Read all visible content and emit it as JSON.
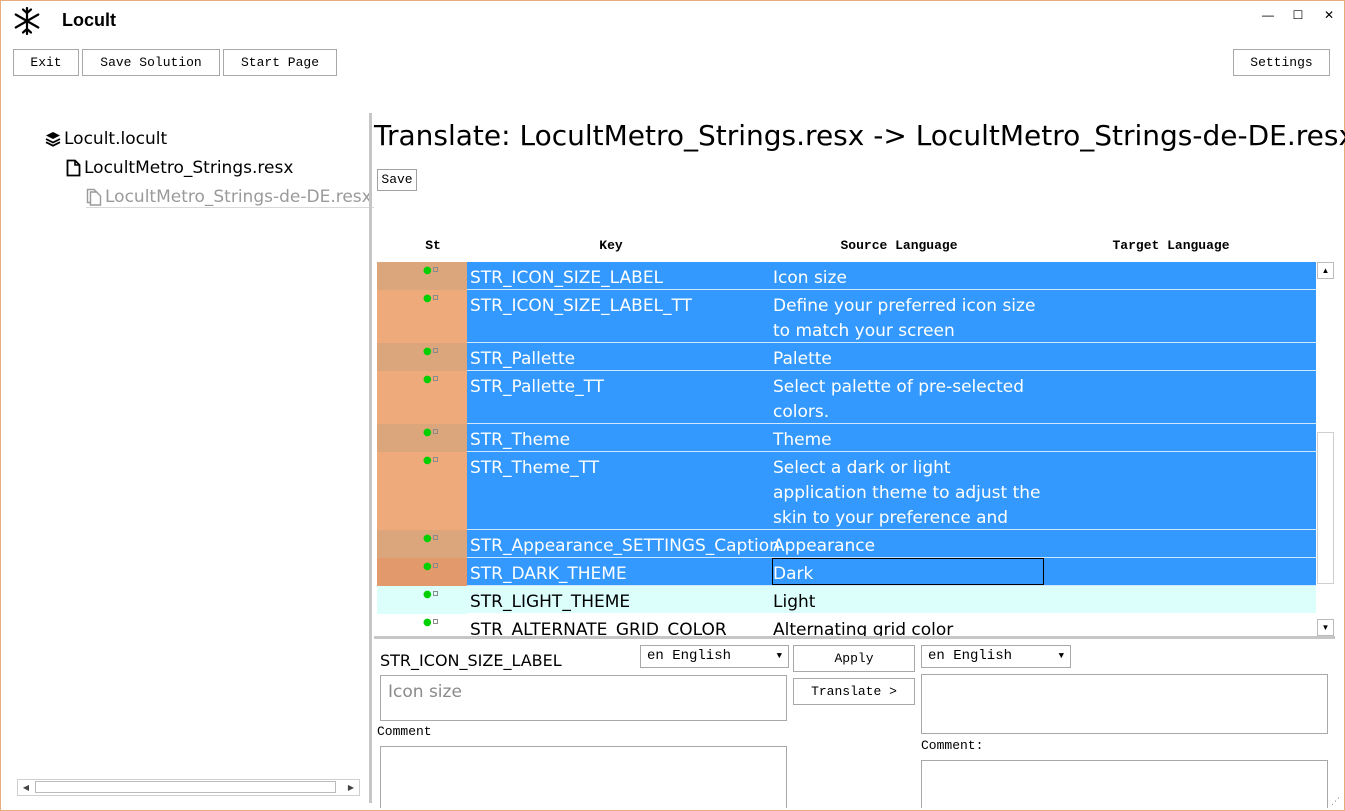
{
  "app": {
    "title": "Locult",
    "icon": "snowflake-icon"
  },
  "window_controls": {
    "minimize": "—",
    "maximize": "☐",
    "close": "✕"
  },
  "toolbar": {
    "exit": "Exit",
    "save_solution": "Save Solution",
    "start_page": "Start Page",
    "settings": "Settings"
  },
  "tree": {
    "items": [
      {
        "label": "Locult.locult",
        "icon": "solution-stack-icon"
      },
      {
        "label": "LocultMetro_Strings.resx",
        "icon": "file-icon"
      },
      {
        "label": "LocultMetro_Strings-de-DE.resx",
        "icon": "copy-file-icon"
      }
    ]
  },
  "main": {
    "title": "Translate: LocultMetro_Strings.resx -> LocultMetro_Strings-de-DE.resx",
    "save": "Save"
  },
  "grid": {
    "columns": [
      "St",
      "Key",
      "Source Language",
      "Target Language"
    ],
    "rows": [
      {
        "key": "STR_ICON_SIZE_LABEL",
        "source": "Icon size"
      },
      {
        "key": "STR_ICON_SIZE_LABEL_TT",
        "source": "Define your preferred icon size to match your screen resolution."
      },
      {
        "key": "STR_Pallette",
        "source": "Palette"
      },
      {
        "key": "STR_Pallette_TT",
        "source": "Select palette of pre-selected colors."
      },
      {
        "key": "STR_Theme",
        "source": "Theme"
      },
      {
        "key": "STR_Theme_TT",
        "source": "Select a dark or light application theme to adjust the skin to your preference and light conditions."
      },
      {
        "key": "STR_Appearance_SETTINGS_Caption",
        "source": "Appearance"
      },
      {
        "key": "STR_DARK_THEME",
        "source": "Dark"
      },
      {
        "key": "STR_LIGHT_THEME",
        "source": "Light"
      },
      {
        "key": "STR_ALTERNATE_GRID_COLOR",
        "source": "Alternating grid color"
      }
    ]
  },
  "editor": {
    "key": "STR_ICON_SIZE_LABEL",
    "source_lang": "en English",
    "target_lang": "en English",
    "apply": "Apply",
    "translate": "Translate >",
    "source_text": "Icon size",
    "comment_label_left": "Comment",
    "comment_label_right": "Comment:"
  },
  "colors": {
    "selection": "#3399ff",
    "status_a": "#dba67c",
    "status_b": "#eeaa7a",
    "status_focus": "#e29a6c",
    "hover": "#dcfffc",
    "window_border": "#e8ad7c"
  }
}
